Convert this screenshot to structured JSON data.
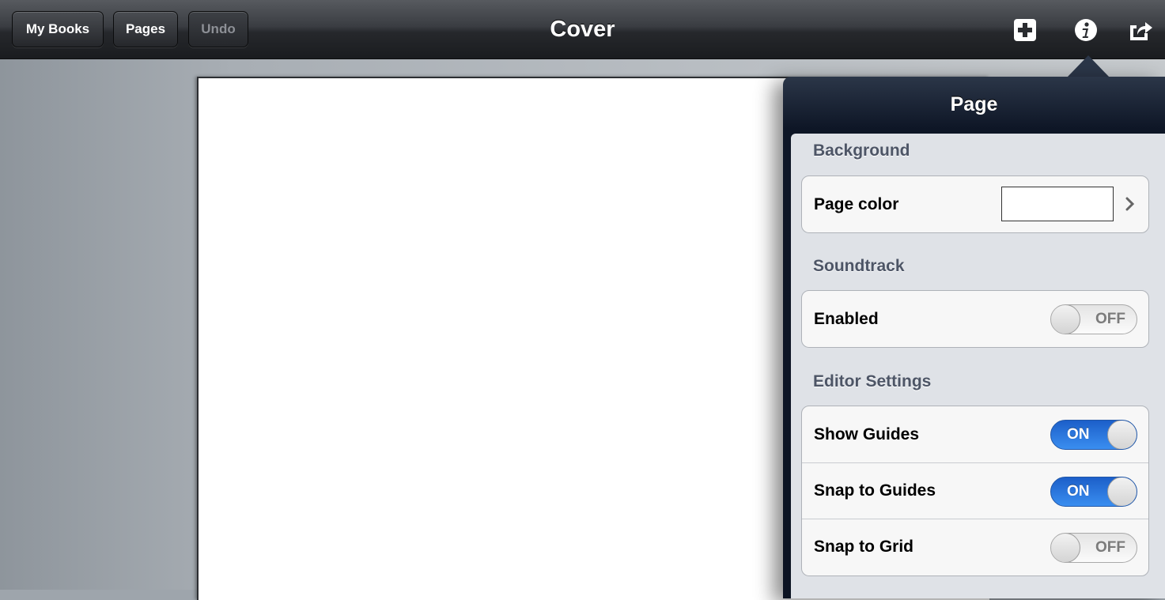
{
  "toolbar": {
    "my_books_label": "My Books",
    "pages_label": "Pages",
    "undo_label": "Undo",
    "title": "Cover",
    "icons": [
      "add-icon",
      "info-icon",
      "share-icon"
    ]
  },
  "popover": {
    "title": "Page",
    "sections": {
      "background": {
        "header": "Background",
        "page_color_label": "Page color",
        "page_color_value": "#ffffff"
      },
      "soundtrack": {
        "header": "Soundtrack",
        "enabled_label": "Enabled",
        "enabled_state": "OFF"
      },
      "editor": {
        "header": "Editor Settings",
        "show_guides_label": "Show Guides",
        "show_guides_state": "ON",
        "snap_guides_label": "Snap to Guides",
        "snap_guides_state": "ON",
        "snap_grid_label": "Snap to Grid",
        "snap_grid_state": "OFF"
      }
    }
  },
  "colors": {
    "toggle_on": "#2f7ee6",
    "toolbar": "#2a2c30",
    "popover_header": "#0e1626"
  }
}
